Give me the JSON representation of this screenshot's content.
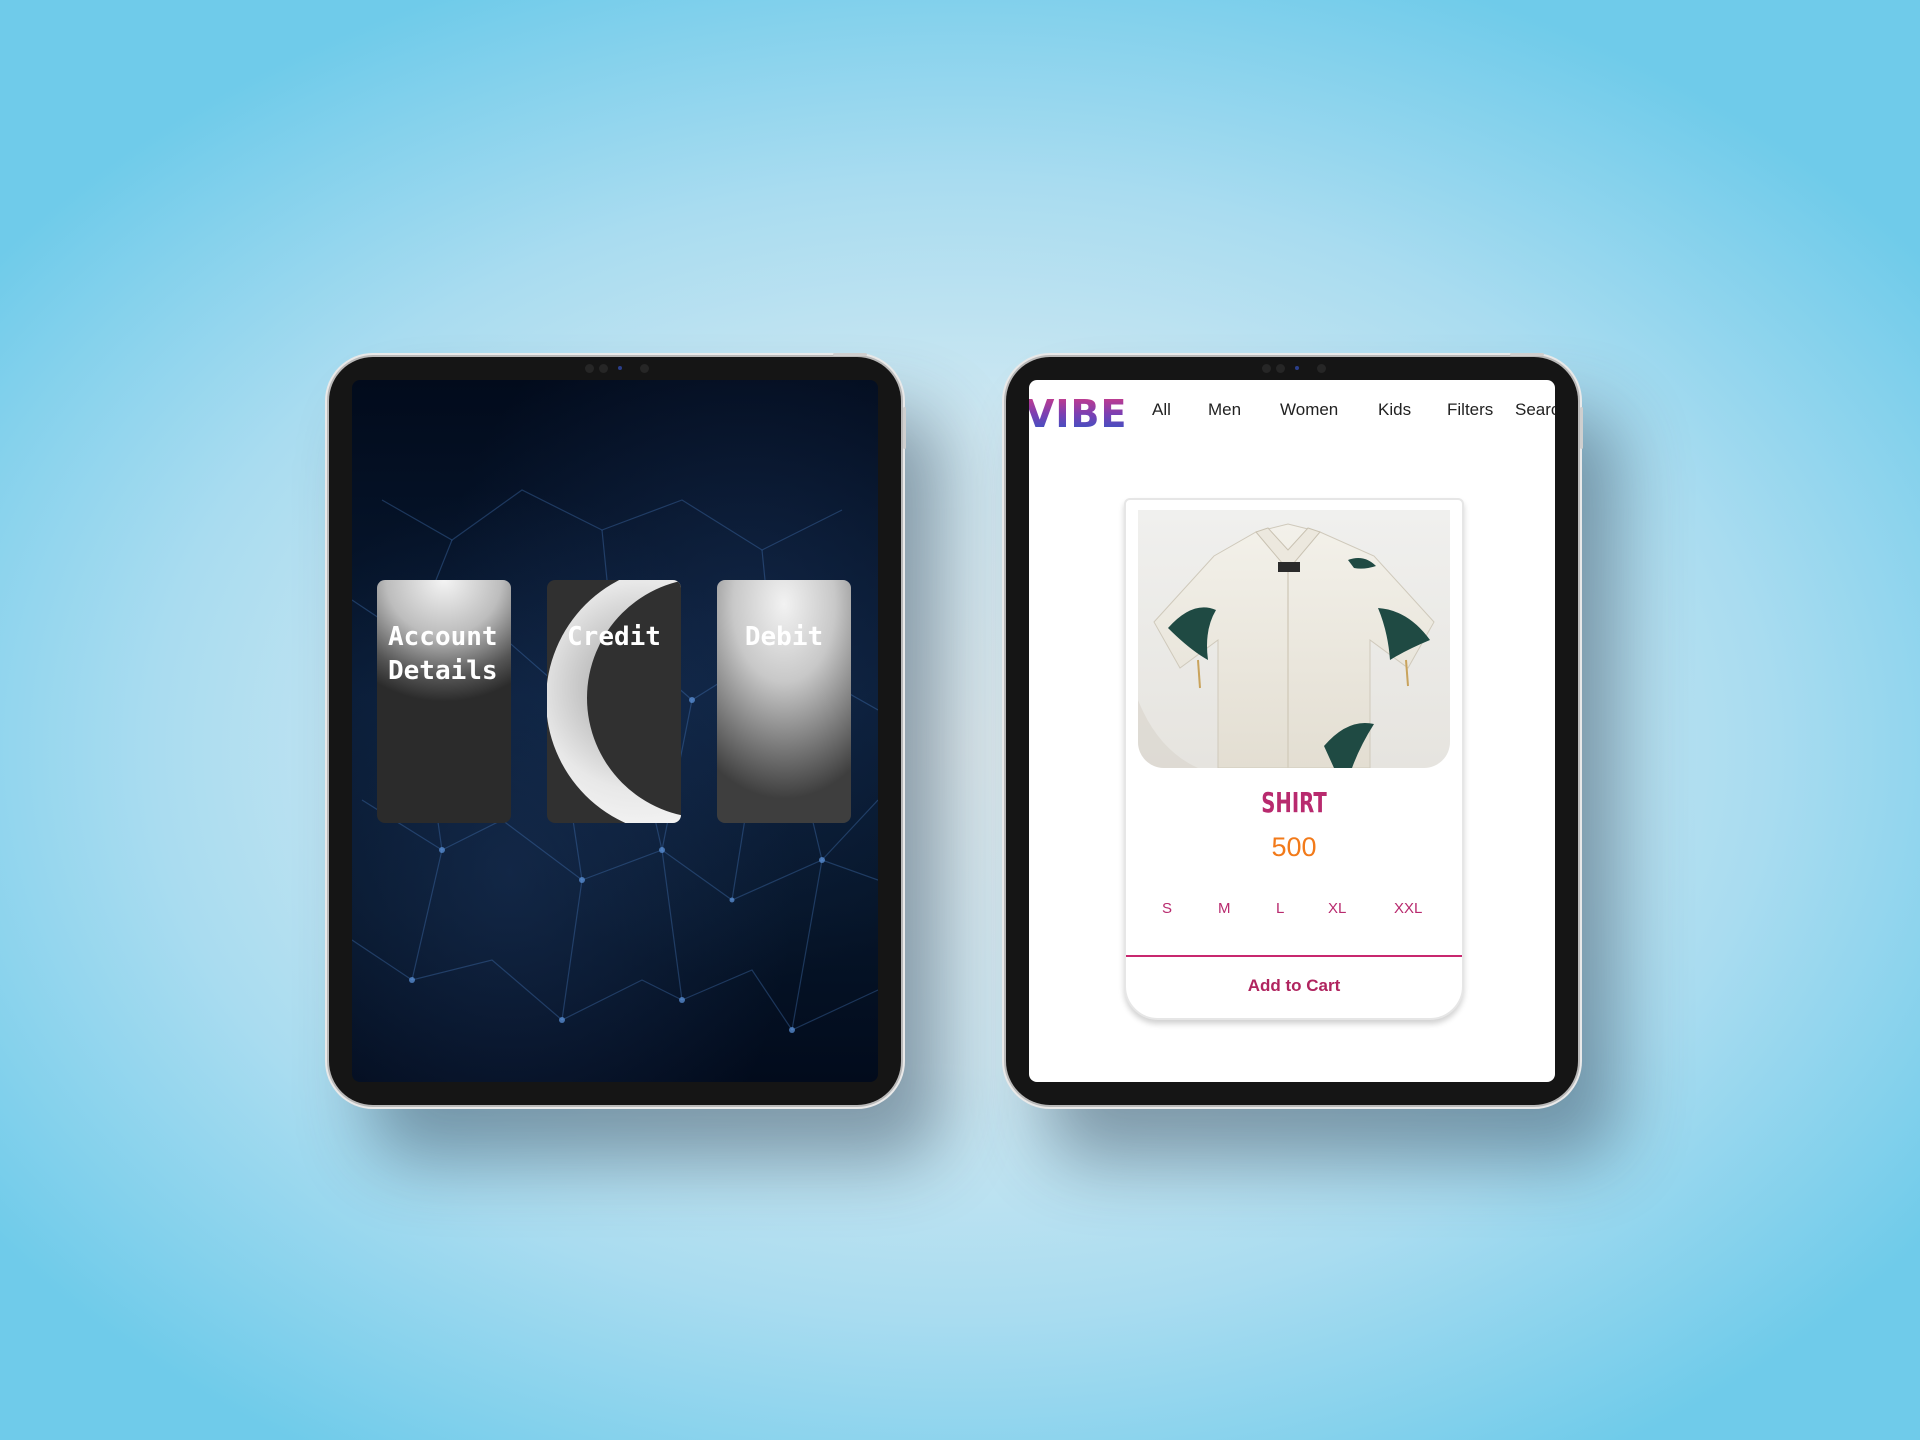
{
  "left_tablet": {
    "cards": [
      {
        "label": "Account\nDetails"
      },
      {
        "label": "Credit"
      },
      {
        "label": "Debit"
      }
    ]
  },
  "right_tablet": {
    "logo": "VIBE",
    "nav": [
      "All",
      "Men",
      "Women",
      "Kids",
      "Filters",
      "Searc"
    ],
    "product": {
      "title": "SHIRT",
      "price": "500",
      "sizes": [
        "S",
        "M",
        "L",
        "XL",
        "XXL"
      ],
      "cta": "Add to Cart"
    }
  },
  "colors": {
    "accent": "#b82a6e",
    "price": "#f27a1a",
    "screen_dark": "#020b1c"
  }
}
